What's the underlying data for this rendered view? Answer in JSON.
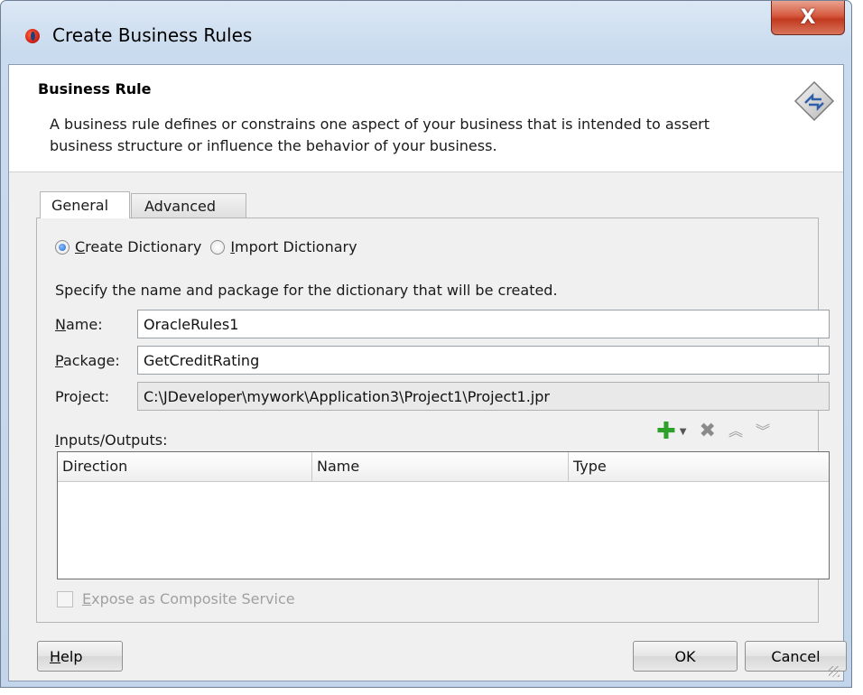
{
  "window": {
    "title": "Create Business Rules",
    "close_glyph": "X"
  },
  "header": {
    "title": "Business Rule",
    "description": "A business rule defines or constrains one aspect of your business that is intended to assert business structure or influence the behavior of your business."
  },
  "tabs": [
    {
      "label": "General",
      "selected": true
    },
    {
      "label": "Advanced",
      "selected": false
    }
  ],
  "dictionary_mode": {
    "create_first": "C",
    "create_rest": "reate Dictionary",
    "import_first": "I",
    "import_rest": "mport Dictionary",
    "selected": "create"
  },
  "instruction": "Specify the name and package for the dictionary that will be created.",
  "fields": {
    "name": {
      "label_first": "N",
      "label_rest": "ame:",
      "value": "OracleRules1"
    },
    "package": {
      "label_first": "P",
      "label_rest": "ackage:",
      "value": "GetCreditRating"
    },
    "project": {
      "label": "Project:",
      "value": "C:\\JDeveloper\\mywork\\Application3\\Project1\\Project1.jpr"
    }
  },
  "io": {
    "label_first": "I",
    "label_rest": "nputs/Outputs:",
    "columns": [
      "Direction",
      "Name",
      "Type"
    ],
    "rows": []
  },
  "expose": {
    "label_first": "E",
    "label_rest": "xpose as Composite Service",
    "checked": false
  },
  "buttons": {
    "help_first": "H",
    "help_rest": "elp",
    "ok": "OK",
    "cancel": "Cancel"
  },
  "icons": {
    "app": "oracle-jdeveloper-icon",
    "rule": "business-rule-diamond-icon",
    "add": "add-icon",
    "delete": "delete-icon",
    "move_up": "move-up-icon",
    "move_down": "move-down-icon"
  }
}
